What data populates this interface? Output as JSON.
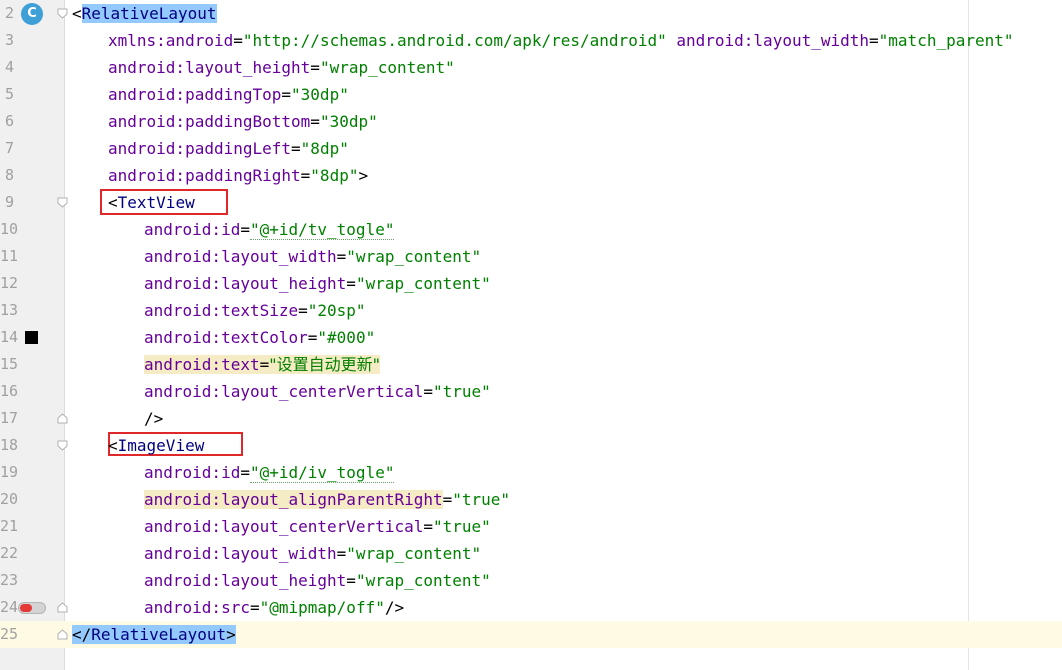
{
  "editor": {
    "line_numbers": [
      "2",
      "3",
      "4",
      "5",
      "6",
      "7",
      "8",
      "9",
      "10",
      "11",
      "12",
      "13",
      "14",
      "15",
      "16",
      "17",
      "18",
      "19",
      "20",
      "21",
      "22",
      "23",
      "24",
      "25"
    ],
    "gutter_icons": {
      "line2": "class-c-icon",
      "line14": "color-swatch-icon",
      "line24": "toggle-switch-icon"
    },
    "colors": {
      "tag": "#000080",
      "attribute": "#660099",
      "value": "#008000",
      "tag_highlight": "#93c9fc",
      "warning_highlight": "#f5ebc4",
      "annotation_box": "#e0282a",
      "swatch": "#000000"
    },
    "code": {
      "l2_tag": "RelativeLayout",
      "l3_attr1": "xmlns:android",
      "l3_val1": "\"http://schemas.android.com/apk/res/android\"",
      "l3_attr2": "android:layout_width",
      "l3_val2": "\"match_parent\"",
      "l4_attr": "android:layout_height",
      "l4_val": "\"wrap_content\"",
      "l5_attr": "android:paddingTop",
      "l5_val": "\"30dp\"",
      "l6_attr": "android:paddingBottom",
      "l6_val": "\"30dp\"",
      "l7_attr": "android:paddingLeft",
      "l7_val": "\"8dp\"",
      "l8_attr": "android:paddingRight",
      "l8_val": "\"8dp\"",
      "l9_tag": "TextView",
      "l10_attr": "android:id",
      "l10_val": "\"@+id/tv_togle\"",
      "l11_attr": "android:layout_width",
      "l11_val": "\"wrap_content\"",
      "l12_attr": "android:layout_height",
      "l12_val": "\"wrap_content\"",
      "l13_attr": "android:textSize",
      "l13_val": "\"20sp\"",
      "l14_attr": "android:textColor",
      "l14_val": "\"#000\"",
      "l15_attr": "android:text",
      "l15_val": "\"设置自动更新\"",
      "l16_attr": "android:layout_centerVertical",
      "l16_val": "\"true\"",
      "l17_close": "/>",
      "l18_tag": "ImageView",
      "l19_attr": "android:id",
      "l19_val": "\"@+id/iv_togle\"",
      "l20_attr": "android:layout_alignParentRight",
      "l20_val": "\"true\"",
      "l21_attr": "android:layout_centerVertical",
      "l21_val": "\"true\"",
      "l22_attr": "android:layout_width",
      "l22_val": "\"wrap_content\"",
      "l23_attr": "android:layout_height",
      "l23_val": "\"wrap_content\"",
      "l24_attr": "android:src",
      "l24_val": "\"@mipmap/off\"",
      "l24_close": "/>",
      "l25_tag": "RelativeLayout"
    }
  }
}
